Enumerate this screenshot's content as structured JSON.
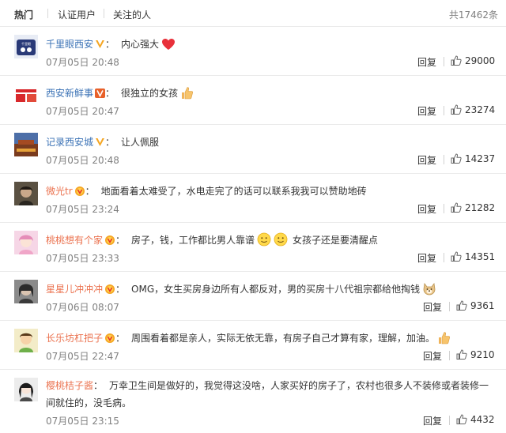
{
  "tabs": {
    "hot": "热门",
    "verified": "认证用户",
    "following": "关注的人",
    "total": "共17462条"
  },
  "reply_label": "回复",
  "colors": {
    "accent": "#eb7350",
    "link": "#3c73b6",
    "muted": "#808080"
  },
  "comments": [
    {
      "user": "千里眼西安",
      "badge": "yellow-v-icon",
      "text": "内心强大",
      "emoji": "heart",
      "time": "07月05日 20:48",
      "likes": "29000"
    },
    {
      "user": "西安新鲜事",
      "badge": "red-v-icon",
      "text": "很独立的女孩",
      "emoji": "thumbs-up",
      "time": "07月05日 20:47",
      "likes": "23274"
    },
    {
      "user": "记录西安城",
      "badge": "yellow-v-icon",
      "text": "让人佩服",
      "emoji": "",
      "time": "07月05日 20:48",
      "likes": "14237"
    },
    {
      "user": "微光tr",
      "badge": "vip-icon",
      "text": "地面看着太难受了，水电走完了的话可以联系我我可以赞助地砖",
      "emoji": "",
      "time": "07月05日 23:24",
      "likes": "21282"
    },
    {
      "user": "桃桃想有个家",
      "badge": "vip-icon",
      "text": "房子，钱，工作都比男人靠谱",
      "text2": "女孩子还是要清醒点",
      "emoji": "two-smiles",
      "time": "07月05日 23:33",
      "likes": "14351"
    },
    {
      "user": "星星儿冲冲冲",
      "badge": "vip-icon",
      "text": "OMG，女生买房身边所有人都反对，男的买房十八代祖宗都给他掏钱",
      "emoji": "doge",
      "time": "07月06日 08:07",
      "likes": "9361"
    },
    {
      "user": "长乐坊杠把子",
      "badge": "vip-icon",
      "text": "周围看着都是亲人，实际无依无靠，有房子自己才算有家，理解，加油。",
      "emoji": "thumbs-up",
      "time": "07月05日 22:47",
      "likes": "9210"
    },
    {
      "user": "樱桃桔子酱",
      "badge": "",
      "text": "万幸卫生间是做好的，我觉得这没啥，人家买好的房子了，农村也很多人不装修或者装修一间就住的，没毛病。",
      "emoji": "",
      "time": "07月05日 23:15",
      "likes": "4432"
    }
  ]
}
